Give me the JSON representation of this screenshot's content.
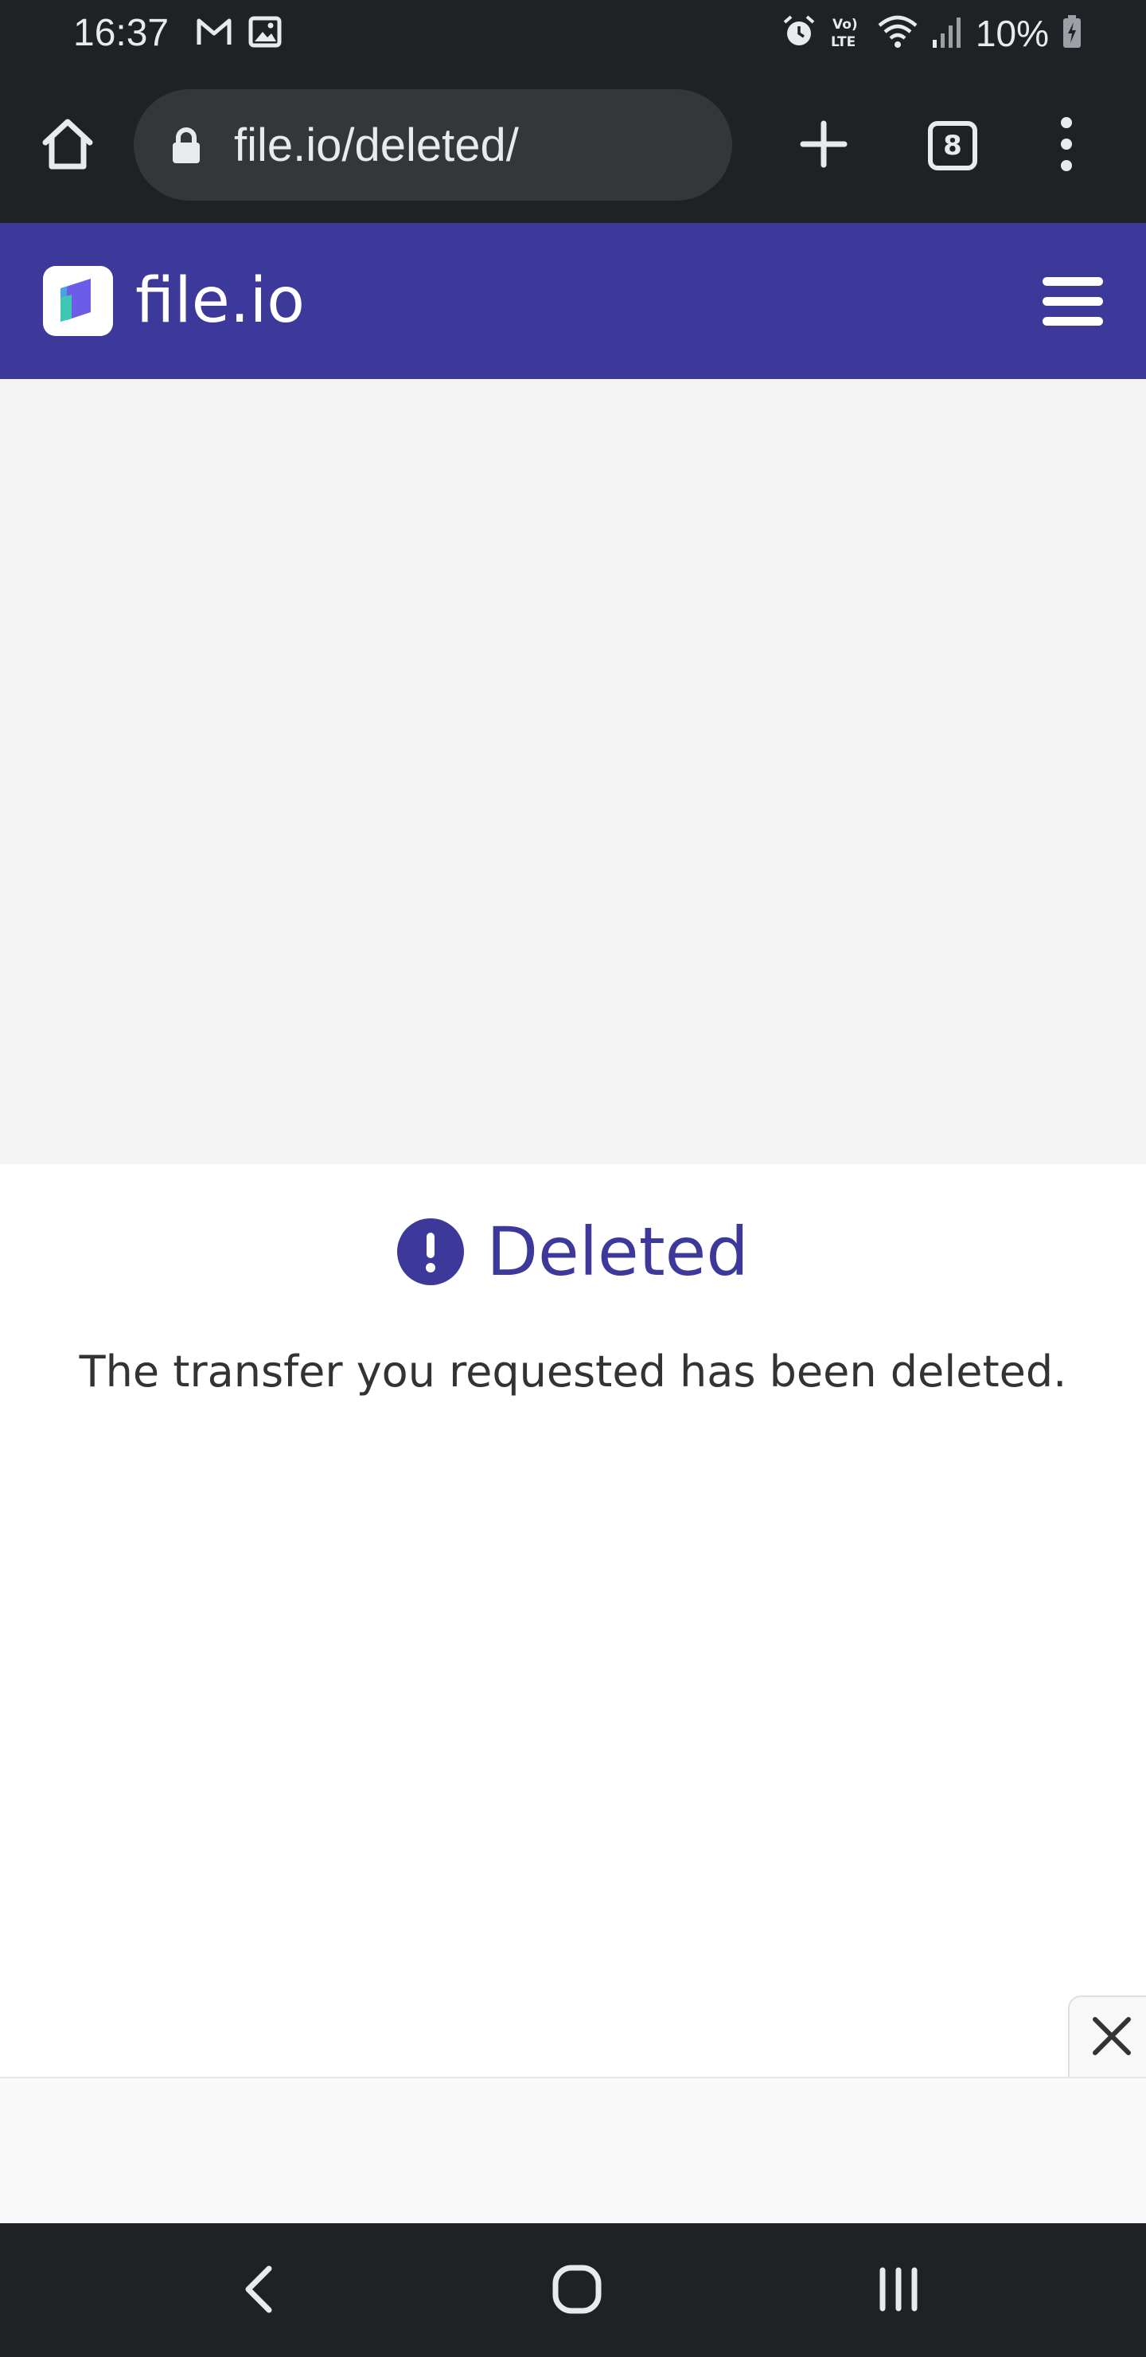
{
  "status_bar": {
    "time": "16:37",
    "battery": "10%",
    "icons": [
      "gmail-icon",
      "gallery-icon",
      "alarm-icon",
      "volte-icon",
      "wifi-icon",
      "signal-icon",
      "battery-charging-icon"
    ]
  },
  "browser": {
    "url": "file.io/deleted/",
    "tab_count": "8",
    "icons": [
      "home-icon",
      "lock-icon",
      "plus-icon",
      "tabs-icon",
      "more-vert-icon"
    ]
  },
  "site": {
    "brand_name": "file.io",
    "brand_color": "#3d399b",
    "icons": [
      "file-io-logo-icon",
      "hamburger-menu-icon"
    ]
  },
  "main": {
    "title": "Deleted",
    "message": "The transfer you requested has been deleted.",
    "icons": [
      "exclamation-circle-icon"
    ]
  },
  "banner": {
    "icons": [
      "close-icon"
    ]
  },
  "nav_bar": {
    "icons": [
      "back-icon",
      "home-circle-icon",
      "recents-icon"
    ]
  }
}
